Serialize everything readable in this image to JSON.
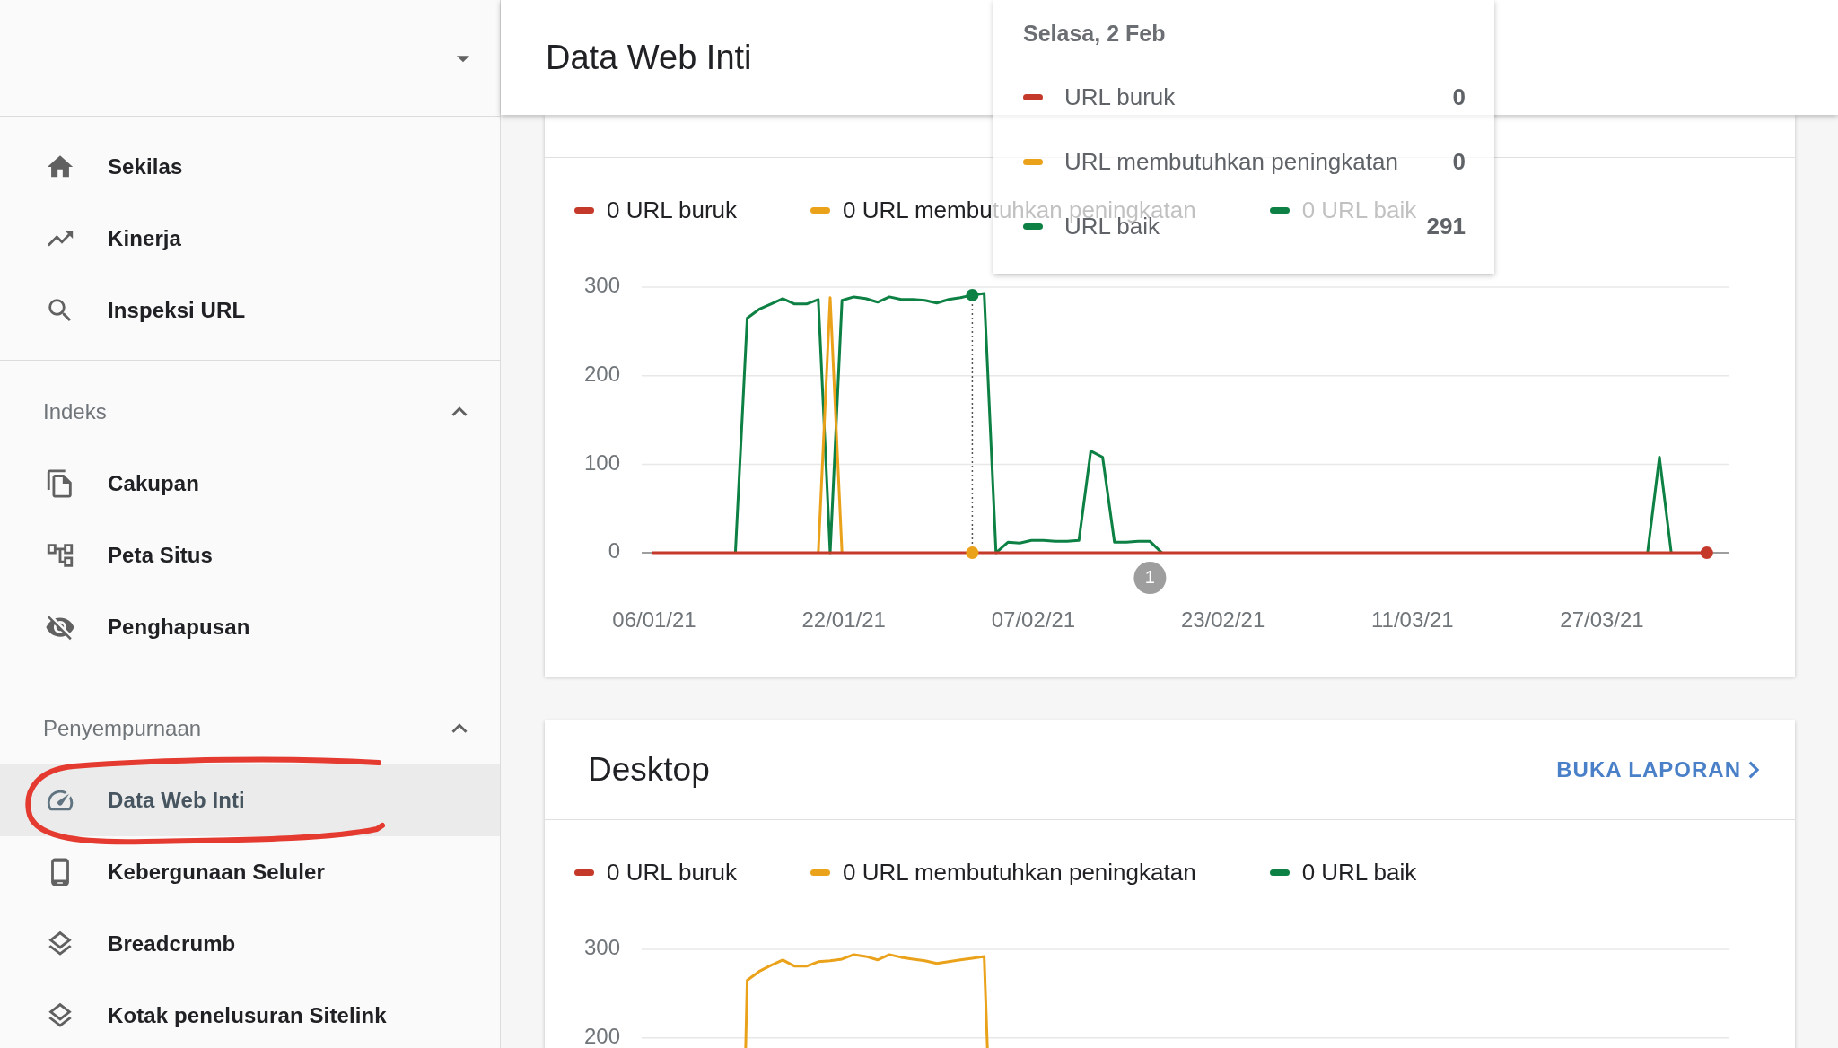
{
  "sidebar": {
    "groups": [
      {
        "items": [
          {
            "label": "Sekilas",
            "selected": false
          },
          {
            "label": "Kinerja",
            "selected": false
          },
          {
            "label": "Inspeksi URL",
            "selected": false
          }
        ]
      },
      {
        "title": "Indeks",
        "expanded": true,
        "items": [
          {
            "label": "Cakupan",
            "selected": false
          },
          {
            "label": "Peta Situs",
            "selected": false
          },
          {
            "label": "Penghapusan",
            "selected": false
          }
        ]
      },
      {
        "title": "Penyempurnaan",
        "expanded": true,
        "items": [
          {
            "label": "Data Web Inti",
            "selected": true
          },
          {
            "label": "Kebergunaan Seluler",
            "selected": false
          },
          {
            "label": "Breadcrumb",
            "selected": false
          },
          {
            "label": "Kotak penelusuran Sitelink",
            "selected": false
          }
        ]
      }
    ]
  },
  "header": {
    "title": "Data Web Inti"
  },
  "tooltip": {
    "date": "Selasa, 2 Feb",
    "rows": [
      {
        "label": "URL buruk",
        "value": "0",
        "color": "#c5392a"
      },
      {
        "label": "URL membutuhkan peningkatan",
        "value": "0",
        "color": "#eba21b"
      },
      {
        "label": "URL baik",
        "value": "291",
        "color": "#0d8043"
      }
    ]
  },
  "cards": [
    {
      "legend": [
        {
          "label": "0 URL buruk",
          "color": "#c5392a"
        },
        {
          "label": "0 URL membutuhkan peningkatan",
          "color": "#eba21b"
        },
        {
          "label": "0 URL baik",
          "color": "#0d8043"
        }
      ],
      "chart_data": {
        "type": "line",
        "categories": [
          "06/01/21",
          null,
          null,
          null,
          null,
          null,
          null,
          null,
          null,
          null,
          null,
          null,
          null,
          null,
          null,
          null,
          "22/01/21",
          null,
          null,
          null,
          null,
          null,
          null,
          null,
          null,
          null,
          null,
          null,
          null,
          null,
          null,
          null,
          "07/02/21",
          null,
          null,
          null,
          null,
          null,
          null,
          null,
          null,
          null,
          null,
          null,
          null,
          null,
          null,
          null,
          "23/02/21",
          null,
          null,
          null,
          null,
          null,
          null,
          null,
          null,
          null,
          null,
          null,
          null,
          null,
          null,
          null,
          "11/03/21",
          null,
          null,
          null,
          null,
          null,
          null,
          null,
          null,
          null,
          null,
          null,
          null,
          null,
          null,
          null,
          "27/03/21",
          null,
          null,
          null,
          null,
          null,
          null,
          null,
          null,
          null
        ],
        "ylim": [
          0,
          300
        ],
        "yticks": [
          0,
          100,
          200,
          300
        ],
        "series": [
          {
            "color": "#c5392a",
            "values": [
              0,
              0,
              0,
              0,
              0,
              0,
              0,
              0,
              0,
              0,
              0,
              0,
              0,
              0,
              0,
              0,
              0,
              0,
              0,
              0,
              0,
              0,
              0,
              0,
              0,
              0,
              0,
              0,
              0,
              0,
              0,
              0,
              0,
              0,
              0,
              0,
              0,
              0,
              0,
              0,
              0,
              0,
              0,
              0,
              0,
              0,
              0,
              0,
              0,
              0,
              0,
              0,
              0,
              0,
              0,
              0,
              0,
              0,
              0,
              0,
              0,
              0,
              0,
              0,
              0,
              0,
              0,
              0,
              0,
              0,
              0,
              0,
              0,
              0,
              0,
              0,
              0,
              0,
              0,
              0,
              0,
              0,
              0,
              0,
              0,
              0,
              0,
              0,
              0,
              0
            ]
          },
          {
            "color": "#eba21b",
            "values": [
              null,
              null,
              null,
              null,
              null,
              null,
              null,
              null,
              null,
              null,
              null,
              null,
              null,
              null,
              0,
              288,
              0,
              null,
              null,
              null,
              null,
              null,
              null,
              null,
              null,
              null,
              null,
              null,
              null,
              null,
              null,
              null,
              null,
              null,
              null,
              null,
              null,
              null,
              null,
              null,
              null,
              null,
              null,
              null,
              null,
              null,
              null,
              null,
              null,
              null,
              null,
              null,
              null,
              null,
              null,
              null,
              null,
              null,
              null,
              null,
              null,
              null,
              null,
              null,
              null,
              null,
              null,
              null,
              null,
              null,
              null,
              null,
              null,
              null,
              null,
              null,
              null,
              null,
              null,
              null,
              null,
              null,
              null,
              null,
              null,
              null,
              null,
              null,
              null,
              null
            ]
          },
          {
            "color": "#0d8043",
            "values": [
              null,
              null,
              null,
              null,
              null,
              null,
              null,
              0,
              265,
              275,
              281,
              287,
              281,
              281,
              286,
              0,
              285,
              289,
              287,
              283,
              289,
              286,
              286,
              285,
              282,
              286,
              288,
              291,
              293,
              0,
              12,
              11,
              14,
              14,
              13,
              13,
              14,
              115,
              108,
              12,
              12,
              13,
              13,
              0,
              null,
              null,
              null,
              null,
              null,
              null,
              null,
              null,
              null,
              null,
              null,
              null,
              null,
              null,
              null,
              null,
              null,
              null,
              null,
              null,
              null,
              null,
              null,
              null,
              null,
              null,
              null,
              null,
              null,
              null,
              null,
              null,
              null,
              null,
              null,
              null,
              null,
              null,
              null,
              null,
              0,
              108,
              0,
              null,
              null,
              null
            ]
          }
        ],
        "annotations": [
          "1"
        ]
      }
    },
    {
      "title": "Desktop",
      "link": "BUKA LAPORAN",
      "legend": [
        {
          "label": "0 URL buruk",
          "color": "#c5392a"
        },
        {
          "label": "0 URL membutuhkan peningkatan",
          "color": "#eba21b"
        },
        {
          "label": "0 URL baik",
          "color": "#0d8043"
        }
      ],
      "chart_data": {
        "type": "line",
        "ylim": [
          200,
          300
        ],
        "yticks": [
          200,
          300
        ],
        "series": [
          {
            "color": "#eba21b",
            "values": [
              null,
              null,
              null,
              null,
              null,
              null,
              null,
              null,
              265,
              275,
              282,
              288,
              281,
              281,
              286,
              287,
              289,
              294,
              292,
              288,
              294,
              291,
              289,
              287,
              284,
              286,
              288,
              290,
              292,
              null,
              null,
              null,
              null,
              null,
              null,
              null,
              null,
              null,
              null,
              null,
              null,
              null,
              null,
              null,
              null,
              null,
              null,
              null,
              null,
              null,
              null,
              null,
              null,
              null,
              null,
              null,
              null,
              null,
              null,
              null,
              null,
              null,
              null,
              null,
              null,
              null,
              null,
              null,
              null,
              null,
              null,
              null,
              null,
              null,
              null,
              null,
              null,
              null,
              null,
              null,
              null,
              null,
              null,
              null,
              null,
              null,
              null,
              null,
              null,
              null
            ]
          }
        ]
      }
    }
  ]
}
